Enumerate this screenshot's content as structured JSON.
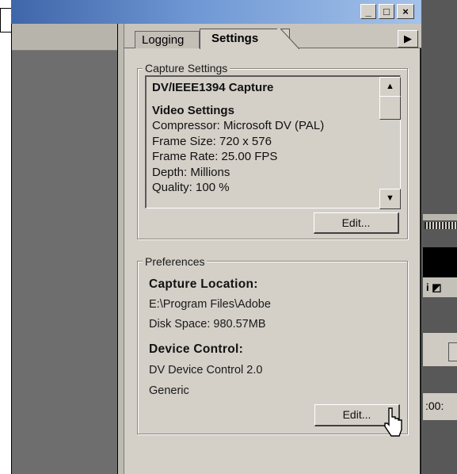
{
  "window": {
    "controls": {
      "minimize": "_",
      "maximize": "□",
      "close": "×"
    }
  },
  "tabs": {
    "logging": "Logging",
    "settings": "Settings",
    "menu_arrow": "▶"
  },
  "capture_settings": {
    "group_label": "Capture Settings",
    "list": [
      {
        "text": "DV/IEEE1394 Capture",
        "bold": true
      },
      {
        "text": "",
        "bold": false
      },
      {
        "text": "Video Settings",
        "bold": true
      },
      {
        "text": "Compressor: Microsoft DV (PAL)",
        "bold": false
      },
      {
        "text": "Frame Size: 720 x 576",
        "bold": false
      },
      {
        "text": "Frame Rate: 25.00 FPS",
        "bold": false
      },
      {
        "text": "Depth: Millions",
        "bold": false
      },
      {
        "text": "Quality: 100 %",
        "bold": false
      }
    ],
    "scroll_up": "▲",
    "scroll_down": "▼",
    "edit_button": "Edit..."
  },
  "preferences": {
    "group_label": "Preferences",
    "capture_location_heading": "Capture Location:",
    "capture_location_path": "E:\\Program Files\\Adobe",
    "disk_space": "Disk Space: 980.57MB",
    "device_control_heading": "Device Control:",
    "device_control_name": "DV Device Control 2.0",
    "device_control_type": "Generic",
    "edit_button": "Edit..."
  },
  "right_strip": {
    "timecode": ":00:",
    "icons_text": "i ◩"
  }
}
